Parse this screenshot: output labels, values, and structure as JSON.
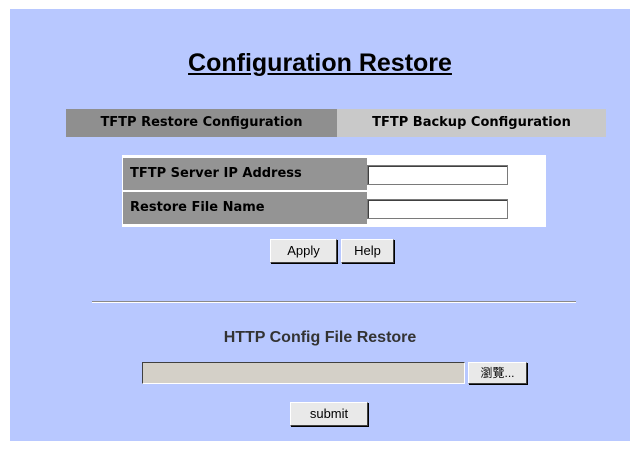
{
  "page": {
    "title": "Configuration Restore"
  },
  "tabs": [
    {
      "label": "TFTP Restore Configuration",
      "active": true
    },
    {
      "label": "TFTP Backup Configuration",
      "active": false
    }
  ],
  "form": {
    "server_ip_label": "TFTP Server IP Address",
    "server_ip_value": "",
    "file_name_label": "Restore File Name",
    "file_name_value": ""
  },
  "buttons": {
    "apply": "Apply",
    "help": "Help"
  },
  "http_restore": {
    "title": "HTTP Config File Restore",
    "file_value": "",
    "browse_label": "瀏覽...",
    "submit_label": "submit"
  },
  "colors": {
    "panel_bg": "#b8c8ff",
    "tab_active": "#8f8f8f",
    "tab_inactive": "#c9c9c9",
    "label_bg": "#949494"
  }
}
